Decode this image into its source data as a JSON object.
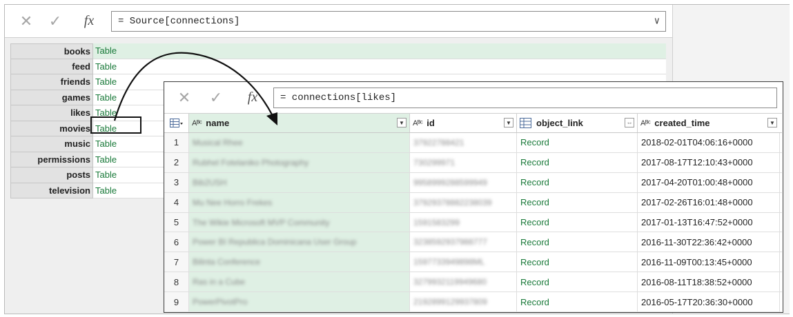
{
  "back_window": {
    "formula": "= Source[connections]",
    "rows": [
      {
        "key": "books",
        "value": "Table"
      },
      {
        "key": "feed",
        "value": "Table"
      },
      {
        "key": "friends",
        "value": "Table"
      },
      {
        "key": "games",
        "value": "Table"
      },
      {
        "key": "likes",
        "value": "Table"
      },
      {
        "key": "movies",
        "value": "Table"
      },
      {
        "key": "music",
        "value": "Table"
      },
      {
        "key": "permissions",
        "value": "Table"
      },
      {
        "key": "posts",
        "value": "Table"
      },
      {
        "key": "television",
        "value": "Table"
      }
    ]
  },
  "front_window": {
    "formula": "= connections[likes]",
    "columns": {
      "name": "name",
      "id": "id",
      "object_link": "object_link",
      "created_time": "created_time",
      "text_type": "Aᴮᶜ"
    },
    "rows": [
      {
        "n": "1",
        "name": "Musical Rhee",
        "id": "37922788421",
        "obj": "Record",
        "time": "2018-02-01T04:06:16+0000"
      },
      {
        "n": "2",
        "name": "Rubhel Fotelaniko Photography",
        "id": "730299971",
        "obj": "Record",
        "time": "2017-08-17T12:10:43+0000"
      },
      {
        "n": "3",
        "name": "Bib2USH",
        "id": "9958999288599949",
        "obj": "Record",
        "time": "2017-04-20T01:00:48+0000"
      },
      {
        "n": "4",
        "name": "Mu Nee Horro Frekes",
        "id": "37929378882238039",
        "obj": "Record",
        "time": "2017-02-26T16:01:48+0000"
      },
      {
        "n": "5",
        "name": "The Wikie Microsoft MVP Community",
        "id": "1591583299",
        "obj": "Record",
        "time": "2017-01-13T16:47:52+0000"
      },
      {
        "n": "6",
        "name": "Power BI Republica Dominicana User Group",
        "id": "3238592937988777",
        "obj": "Record",
        "time": "2016-11-30T22:36:42+0000"
      },
      {
        "n": "7",
        "name": "Bilinta Conference",
        "id": "1597733949898ML",
        "obj": "Record",
        "time": "2016-11-09T00:13:45+0000"
      },
      {
        "n": "8",
        "name": "Ras in a Cube",
        "id": "3279932119949680",
        "obj": "Record",
        "time": "2016-08-11T18:38:52+0000"
      },
      {
        "n": "9",
        "name": "PowerPivotPro",
        "id": "2192899129937809",
        "obj": "Record",
        "time": "2016-05-17T20:36:30+0000"
      }
    ]
  },
  "icons": {
    "cancel": "✕",
    "commit": "✓",
    "fx": "fx",
    "chevron": "⌵"
  }
}
